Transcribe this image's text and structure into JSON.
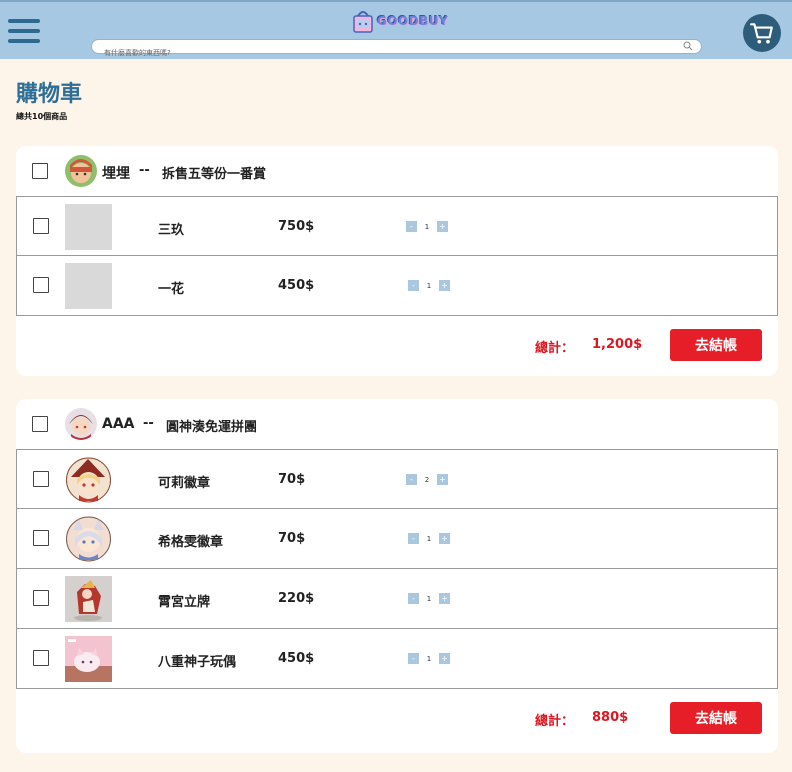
{
  "header": {
    "logo_text": "GOODBUY",
    "search_placeholder": "有什麼喜歡的東西嗎?"
  },
  "page": {
    "title": "購物車",
    "item_count": "總共10個商品"
  },
  "sellers": [
    {
      "name": "埋埋",
      "separator": "--",
      "title": "拆售五等份一番賞",
      "items": [
        {
          "name": "三玖",
          "price": "750$",
          "qty": "1"
        },
        {
          "name": "一花",
          "price": "450$",
          "qty": "1"
        }
      ],
      "total_label": "總計：",
      "total": "1,200$",
      "checkout_label": "去結帳"
    },
    {
      "name": "AAA",
      "separator": "--",
      "title": "圓神湊免運拼團",
      "items": [
        {
          "name": "可莉徽章",
          "price": "70$",
          "qty": "2"
        },
        {
          "name": "希格雯徽章",
          "price": "70$",
          "qty": "1"
        },
        {
          "name": "霄宮立牌",
          "price": "220$",
          "qty": "1"
        },
        {
          "name": "八重神子玩偶",
          "price": "450$",
          "qty": "1"
        }
      ],
      "total_label": "總計：",
      "total": "880$",
      "checkout_label": "去結帳"
    }
  ],
  "qty_controls": {
    "minus": "-",
    "plus": "+"
  },
  "colors": {
    "header_bg": "#a6c8e2",
    "accent": "#2f6e96",
    "checkout": "#e61e27",
    "total": "#e0151f",
    "page_bg": "#fdf5ea"
  },
  "icons": [
    "menu-icon",
    "search-icon",
    "cart-icon",
    "bag-logo-icon"
  ]
}
